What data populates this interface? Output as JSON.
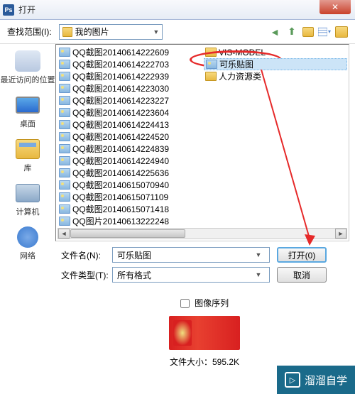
{
  "titlebar": {
    "icon_text": "Ps",
    "title": "打开",
    "close_icon": "✕"
  },
  "toolbar": {
    "lookfor_label": "查找范围(I):",
    "lookfor_value": "我的图片",
    "back_icon": "◄",
    "up_icon": "⬆",
    "views_arrow": "▾",
    "combo_arrow": "▼"
  },
  "places": [
    {
      "label": "最近访问的位置"
    },
    {
      "label": "桌面"
    },
    {
      "label": "库"
    },
    {
      "label": "计算机"
    },
    {
      "label": "网络"
    }
  ],
  "files_col1": [
    "QQ截图20140614222609",
    "QQ截图20140614222703",
    "QQ截图20140614222939",
    "QQ截图20140614223030",
    "QQ截图20140614223227",
    "QQ截图20140614223604",
    "QQ截图20140614224413",
    "QQ截图20140614224520",
    "QQ截图20140614224839",
    "QQ截图20140614224940",
    "QQ截图20140614225636",
    "QQ截图20140615070940",
    "QQ截图20140615071109",
    "QQ截图20140615071418",
    "QQ图片20140613222248"
  ],
  "files_col2": [
    {
      "name": "VIS-MODEL",
      "type": "folder"
    },
    {
      "name": "可乐贴图",
      "type": "image",
      "selected": true,
      "highlighted": true
    },
    {
      "name": "人力资源类",
      "type": "folder"
    }
  ],
  "form": {
    "filename_label": "文件名(N):",
    "filename_value": "可乐贴图",
    "filetype_label": "文件类型(T):",
    "filetype_value": "所有格式",
    "open_label": "打开(0)",
    "cancel_label": "取消",
    "combo_arrow": "▼"
  },
  "checkbox": {
    "label": "图像序列"
  },
  "preview": {
    "size_label": "文件大小：",
    "size_value": "595.2K"
  },
  "scrollbar": {
    "left": "◄",
    "right": "►"
  },
  "watermark": {
    "icon": "▷",
    "text": "溜溜自学"
  }
}
